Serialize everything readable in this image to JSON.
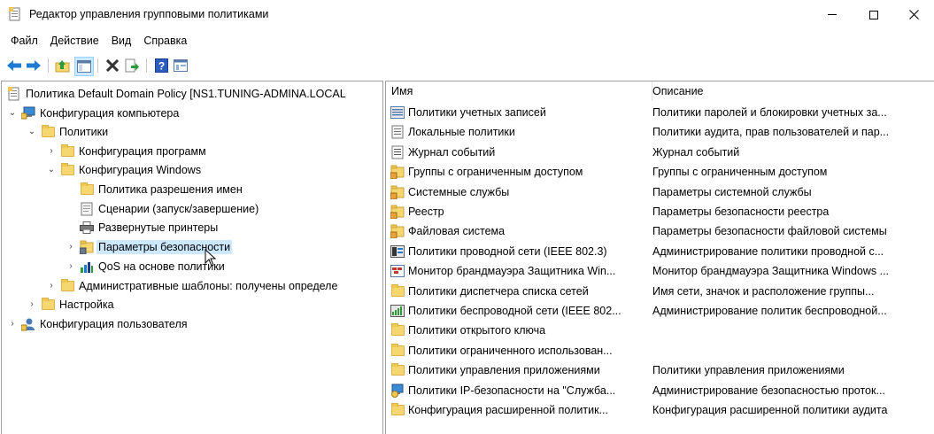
{
  "window": {
    "title": "Редактор управления групповыми политиками",
    "min_glyph": "—",
    "max_glyph": "☐",
    "close_glyph": "✕"
  },
  "menu": [
    "Файл",
    "Действие",
    "Вид",
    "Справка"
  ],
  "toolbar": [
    "back-icon",
    "forward-icon",
    "up-folder-icon",
    "show-hide-tree-icon",
    "delete-icon",
    "export-list-icon",
    "help-icon",
    "properties-icon"
  ],
  "tree": [
    {
      "label": "Политика Default Domain Policy [NS1.TUNING-ADMINA.LOCAL",
      "icon": "policy-icon"
    },
    {
      "label": "Конфигурация компьютера",
      "icon": "computer-icon",
      "expanded": true
    },
    {
      "label": "Политики",
      "icon": "folder-icon",
      "expanded": true
    },
    {
      "label": "Конфигурация программ",
      "icon": "folder-icon",
      "expanded": false
    },
    {
      "label": "Конфигурация Windows",
      "icon": "folder-icon",
      "expanded": true
    },
    {
      "label": "Политика разрешения имен",
      "icon": "folder-icon"
    },
    {
      "label": "Сценарии (запуск/завершение)",
      "icon": "script-icon"
    },
    {
      "label": "Развернутые принтеры",
      "icon": "printer-icon"
    },
    {
      "label": "Параметры безопасности",
      "icon": "security-settings-icon",
      "selected": true,
      "expanded": false
    },
    {
      "label": "QoS на основе политики",
      "icon": "qos-chart-icon",
      "expanded": false
    },
    {
      "label": "Административные шаблоны: получены определе",
      "icon": "folder-icon",
      "expanded": false
    },
    {
      "label": "Настройка",
      "icon": "folder-icon",
      "expanded": false
    },
    {
      "label": "Конфигурация пользователя",
      "icon": "user-icon",
      "expanded": false
    }
  ],
  "list": {
    "columns": [
      "Имя",
      "Описание"
    ],
    "rows": [
      {
        "name": "Политики учетных записей",
        "desc": "Политики паролей и блокировки учетных за...",
        "icon": "account-policy-icon"
      },
      {
        "name": "Локальные политики",
        "desc": "Политики аудита, прав пользователей и пар...",
        "icon": "local-policy-icon"
      },
      {
        "name": "Журнал событий",
        "desc": "Журнал событий",
        "icon": "event-log-icon"
      },
      {
        "name": "Группы с ограниченным доступом",
        "desc": "Группы с ограниченным доступом",
        "icon": "secure-folder-icon"
      },
      {
        "name": "Системные службы",
        "desc": "Параметры системной службы",
        "icon": "secure-folder-icon"
      },
      {
        "name": "Реестр",
        "desc": "Параметры безопасности реестра",
        "icon": "secure-folder-icon"
      },
      {
        "name": "Файловая система",
        "desc": "Параметры безопасности файловой системы",
        "icon": "secure-folder-icon"
      },
      {
        "name": "Политики проводной сети (IEEE 802.3)",
        "desc": "Администрирование политики проводной с...",
        "icon": "wired-network-icon"
      },
      {
        "name": "Монитор брандмауэра Защитника Win...",
        "desc": "Монитор брандмауэра Защитника Windows ...",
        "icon": "firewall-icon"
      },
      {
        "name": "Политики диспетчера списка сетей",
        "desc": "Имя сети, значок и расположение группы...",
        "icon": "folder-icon"
      },
      {
        "name": "Политики беспроводной сети (IEEE 802...",
        "desc": "Администрирование политик беспроводной...",
        "icon": "wireless-network-icon"
      },
      {
        "name": "Политики открытого ключа",
        "desc": "",
        "icon": "folder-icon"
      },
      {
        "name": "Политики ограниченного использован...",
        "desc": "",
        "icon": "folder-icon"
      },
      {
        "name": "Политики управления приложениями",
        "desc": "Политики управления приложениями",
        "icon": "folder-icon"
      },
      {
        "name": "Политики IP-безопасности на \"Служба...",
        "desc": "Администрирование безопасностью проток...",
        "icon": "ipsec-icon"
      },
      {
        "name": "Конфигурация расширенной политик...",
        "desc": "Конфигурация расширенной политики аудита",
        "icon": "folder-icon"
      }
    ]
  },
  "colors": {
    "selection": "#cce8ff",
    "folder": "#f6d66f",
    "nav_arrow": "#1e7bd2"
  }
}
